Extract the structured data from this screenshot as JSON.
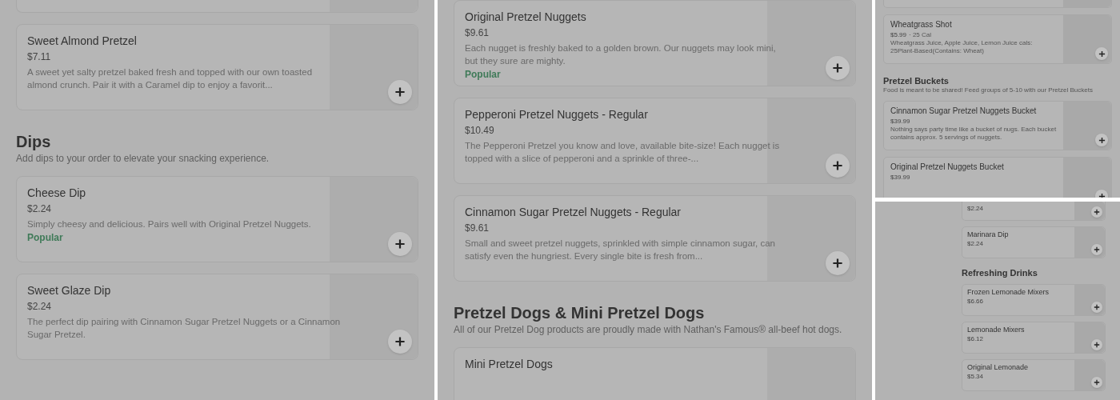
{
  "panels": [
    {
      "kind": "large",
      "items": [
        {
          "kind": "stub"
        },
        {
          "kind": "card",
          "title": "Sweet Almond Pretzel",
          "price": "$7.11",
          "description": "A sweet yet salty pretzel baked fresh and topped with our own toasted almond crunch. Pair it with a Caramel dip to enjoy a favorit..."
        },
        {
          "kind": "heading",
          "title": "Dips",
          "subtitle": "Add dips to your order to elevate your snacking experience."
        },
        {
          "kind": "card",
          "title": "Cheese Dip",
          "price": "$2.24",
          "description": "Simply cheesy and delicious. Pairs well with Original Pretzel Nuggets.",
          "badge": "Popular"
        },
        {
          "kind": "card",
          "title": "Sweet Glaze Dip",
          "price": "$2.24",
          "description": "The perfect dip pairing with Cinnamon Sugar Pretzel Nuggets or a Cinnamon Sugar Pretzel."
        }
      ]
    },
    {
      "kind": "large",
      "items": [
        {
          "kind": "card",
          "title": "Original Pretzel Nuggets",
          "price": "$9.61",
          "description": "Each nugget is freshly baked to a golden brown. Our nuggets may look mini, but they sure are mighty.",
          "badge": "Popular"
        },
        {
          "kind": "card",
          "title": "Pepperoni Pretzel Nuggets - Regular",
          "price": "$10.49",
          "description": "The Pepperoni Pretzel you know and love, available bite-size! Each nugget is topped with a slice of pepperoni and a sprinkle of three-..."
        },
        {
          "kind": "card",
          "title": "Cinnamon Sugar Pretzel Nuggets - Regular",
          "price": "$9.61",
          "description": "Small and sweet pretzel nuggets, sprinkled with simple cinnamon sugar, can satisfy even the hungriest. Every single bite is fresh from..."
        },
        {
          "kind": "heading",
          "title": "Pretzel Dogs & Mini Pretzel Dogs",
          "subtitle": "All of our Pretzel Dog products are proudly made with Nathan's Famous® all-beef hot dogs."
        },
        {
          "kind": "card",
          "title": "Mini Pretzel Dogs"
        }
      ]
    },
    {
      "kind": "small",
      "items": [
        {
          "kind": "stub"
        },
        {
          "kind": "card",
          "title": "Wheatgrass Shot",
          "price": "$5.99",
          "calories": "· 25 Cal",
          "description": "Wheatgrass Juice, Apple Juice, Lemon Juice cals: 25Plant-Based(Contains: Wheat)"
        },
        {
          "kind": "heading",
          "title": "Pretzel Buckets",
          "subtitle": "Food is meant to be shared! Feed groups of 5-10 with our Pretzel Buckets"
        },
        {
          "kind": "card",
          "title": "Cinnamon Sugar Pretzel Nuggets Bucket",
          "price": "$39.99",
          "description": "Nothing says party time like a bucket of nugs. Each bucket contains approx. 5 servings of nuggets."
        },
        {
          "kind": "card",
          "title": "Original Pretzel Nuggets Bucket",
          "price": "$39.99"
        }
      ]
    },
    {
      "kind": "tiny",
      "items": [
        {
          "kind": "card",
          "price": "$2.24"
        },
        {
          "kind": "card",
          "title": "Marinara Dip",
          "price": "$2.24"
        },
        {
          "kind": "heading",
          "title": "Refreshing Drinks"
        },
        {
          "kind": "card",
          "title": "Frozen Lemonade Mixers",
          "price": "$6.66"
        },
        {
          "kind": "card",
          "title": "Lemonade Mixers",
          "price": "$6.12"
        },
        {
          "kind": "card",
          "title": "Original Lemonade",
          "price": "$5.34"
        }
      ]
    }
  ]
}
